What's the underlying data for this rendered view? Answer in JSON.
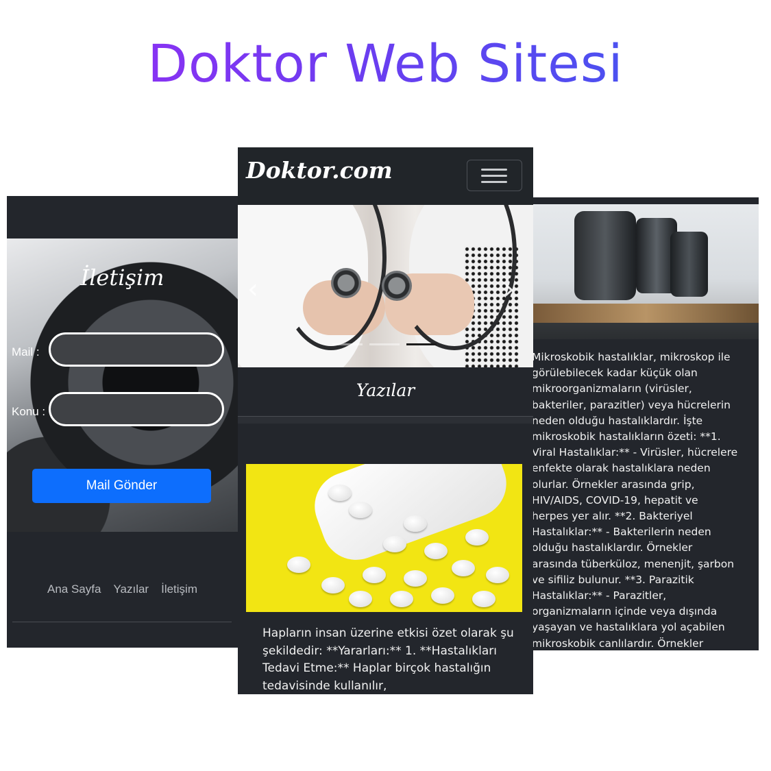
{
  "title": "Doktor Web Sitesi",
  "contact": {
    "heading": "İletişim",
    "mail_label": "Mail :",
    "konu_label": "Konu :",
    "mail_value": "",
    "konu_value": "",
    "send_button": "Mail Gönder",
    "footer_links": [
      "Ana Sayfa",
      "Yazılar",
      "İletişim"
    ]
  },
  "home": {
    "brand": "Doktor.com",
    "carousel_prev": "‹",
    "carousel_next": "›",
    "carousel_indicator_count": 3,
    "carousel_active_index": 2,
    "section_title": "Yazılar",
    "card_text": "Hapların insan üzerine etkisi özet olarak şu şekildedir: **Yararları:** 1. **Hastalıkları Tedavi Etme:** Haplar birçok hastalığın tedavisinde kullanılır,"
  },
  "article": {
    "text": "Mikroskobik hastalıklar, mikroskop ile\ngörülebilecek kadar küçük olan\nmikroorganizmaların (virüsler,\nbakteriler, parazitler) veya hücrelerin\nneden olduğu hastalıklardır. İşte\nmikroskobik hastalıkların özeti: **1.\nViral Hastalıklar:** - Virüsler, hücrelere\nenfekte olarak hastalıklara neden\nolurlar. Örnekler arasında grip,\nHIV/AIDS, COVID-19, hepatit ve\nherpes yer alır. **2. Bakteriyel\nHastalıklar:** - Bakterilerin neden\nolduğu hastalıklardır. Örnekler\narasında tüberküloz, menenjit, şarbon\nve sifiliz bulunur. **3. Parazitik\nHastalıklar:** - Parazitler,\norganizmaların içinde veya dışında\nyaşayan ve hastalıklara yol açabilen\nmikroskobik canlılardır. Örnekler"
  },
  "colors": {
    "title_gradient": [
      "#9b2cf5",
      "#3a5bf0"
    ],
    "dark_bg": "#23262c",
    "primary_button": "#0d6efd"
  },
  "icons": {
    "menu": "hamburger-icon",
    "prev": "chevron-left-icon",
    "next": "chevron-right-icon"
  }
}
